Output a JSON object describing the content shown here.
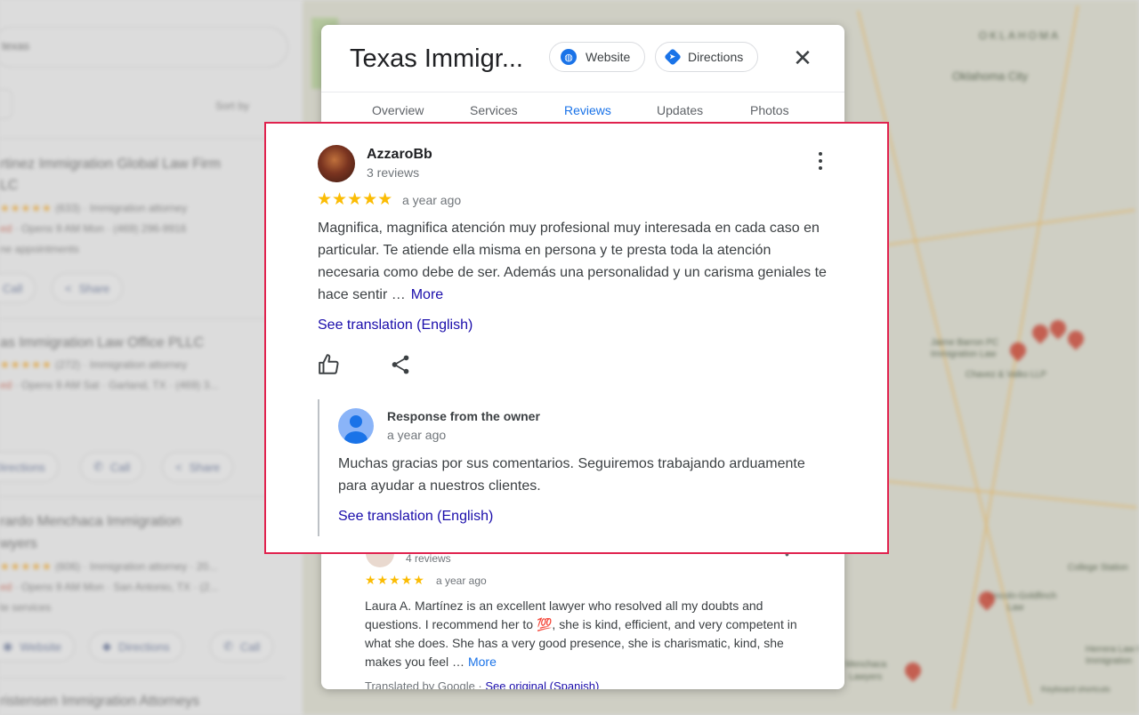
{
  "background": {
    "search_text": "texas",
    "sort_label": "Sort by",
    "listings": [
      {
        "name": "rtinez Immigration Global Law Firm",
        "name2": "LC",
        "rating": "(633)",
        "category": "Immigration attorney",
        "hours": "Opens 9 AM Mon",
        "phone": "(469) 296-9916",
        "extra": "ne appointments",
        "btn1": "Call",
        "btn2": "Share"
      },
      {
        "name": "as Immigration Law Office PLLC",
        "rating": "(272)",
        "category": "Immigration attorney",
        "hours": "Opens 9 AM Sat",
        "place": "Garland, TX",
        "phone": "(469) 3...",
        "btn1": "Directions",
        "btn2": "Call",
        "btn3": "Share"
      },
      {
        "name": "rardo Menchaca Immigration",
        "name2": "wyers",
        "rating": "(606)",
        "category": "Immigration attorney · 20...",
        "hours": "Opens 9 AM Mon",
        "place": "San Antonio, TX",
        "phone": "(2...",
        "extra": "te services",
        "btn1": "Website",
        "btn2": "Directions",
        "btn3": "Call"
      },
      {
        "name": "ristensen Immigration Attorneys"
      }
    ],
    "map_labels": {
      "state": "OKLAHOMA",
      "city": "Oklahoma City",
      "firm1": "Jaime Barron PC",
      "firm1b": "Immigration Law",
      "firm2": "Chavez & Valko LLP",
      "firm3": "Lincoln-Goldfinch",
      "firm3b": "Law",
      "firm4": "Herrera Law Firm",
      "firm4b": "Immigration",
      "city2": "College Station",
      "firm5": "Menchaca",
      "firm5b": "Lawyers",
      "footer": "Keyboard shortcuts"
    }
  },
  "card": {
    "title": "Texas Immigr...",
    "website_label": "Website",
    "directions_label": "Directions",
    "close_label": "✕",
    "tabs": [
      "Overview",
      "Services",
      "Reviews",
      "Updates",
      "Photos"
    ],
    "active_tab": "Reviews"
  },
  "review": {
    "author": "AzzaroBb",
    "author_meta": "3 reviews",
    "stars": "★★★★★",
    "rating": 5,
    "time": "a year ago",
    "text": "Magnifica, magnifica atención muy profesional muy interesada en cada caso en particular. Te atiende ella misma en persona y te presta toda la atención necesaria como debe de ser. Además una personalidad y un carisma geniales te hace sentir …",
    "more_label": "More",
    "see_translation": "See translation (English)",
    "response": {
      "label": "Response from the owner",
      "time": "a year ago",
      "text": "Muchas gracias por sus comentarios. Seguiremos trabajando arduamente para ayudar a nuestros clientes.",
      "see_translation": "See translation (English)"
    }
  },
  "second_review": {
    "author_meta": "4 reviews",
    "stars": "★★★★★",
    "rating": 5,
    "time": "a year ago",
    "text": "Laura A. Martínez is an excellent lawyer who resolved all my doubts and questions. I recommend her to 💯, she is kind, efficient, and very competent in what she does. She has a very good presence, she is charismatic, kind, she makes you feel …",
    "more_label": "More",
    "translated_prefix": "Translated by Google · ",
    "see_original": "See original (Spanish)"
  },
  "colors": {
    "highlight_border": "#e0224e",
    "link_blue": "#1a0dab",
    "accent_blue": "#1a73e8",
    "star_yellow": "#fbbc04"
  },
  "icons": [
    "globe-icon",
    "directions-icon",
    "close-icon",
    "more-vert-icon",
    "thumbs-up-icon",
    "share-icon",
    "owner-avatar-icon"
  ]
}
